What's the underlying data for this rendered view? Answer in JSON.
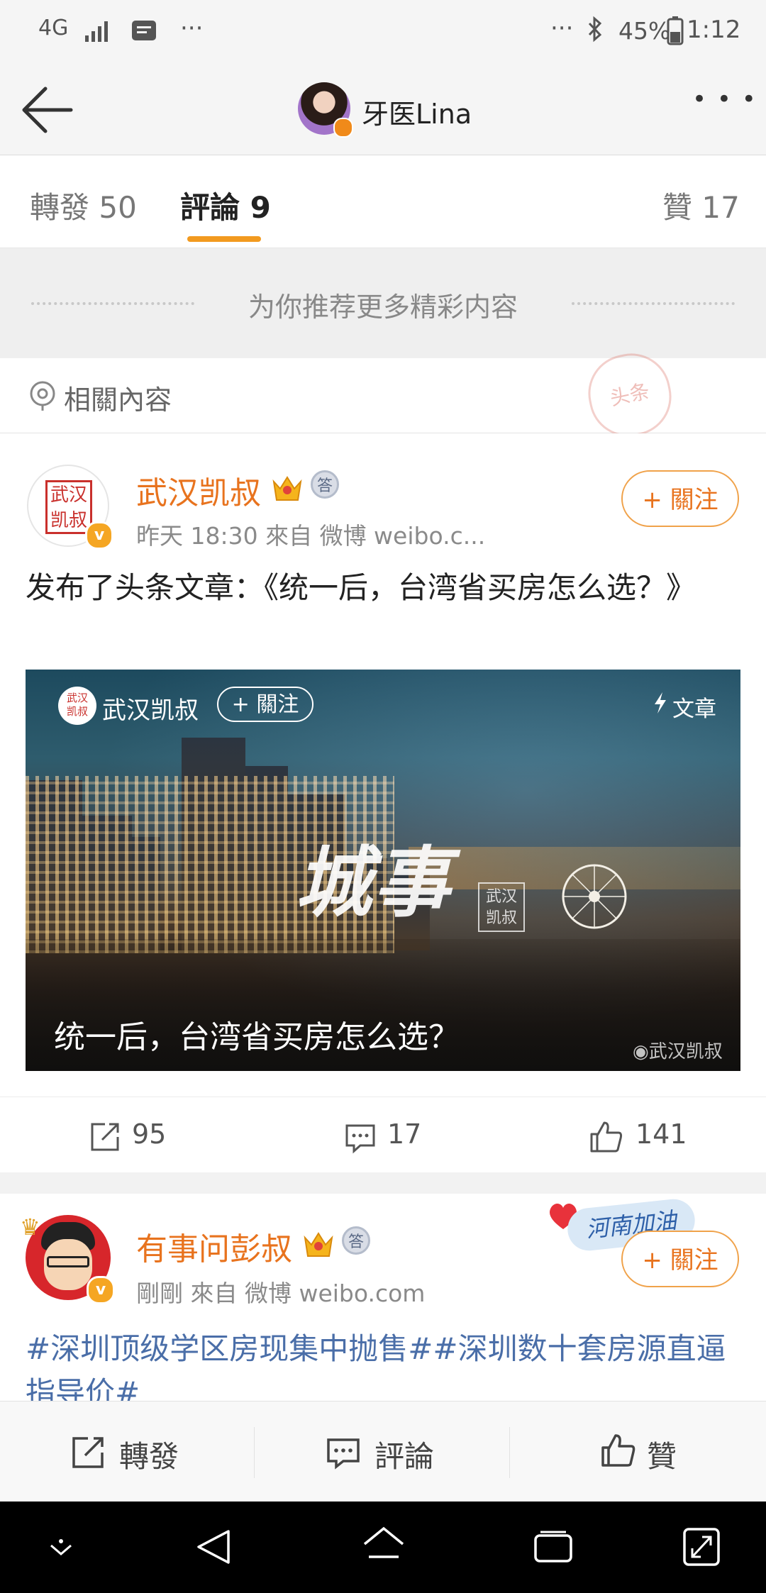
{
  "status_bar": {
    "network": "4G",
    "battery": "45%",
    "time": "1:12",
    "dots_left": "···",
    "dots_right": "···"
  },
  "header": {
    "title": "牙医Lina",
    "more_label": "• • •"
  },
  "tabs": {
    "repost": "轉發 50",
    "comment": "評論 9",
    "like": "贊 17",
    "active_color": "#f29a1f"
  },
  "recommend": {
    "text": "为你推荐更多精彩内容"
  },
  "related": {
    "label": "相關內容"
  },
  "post1": {
    "avatar_text": "武汉\n凯叔",
    "name": "武汉凯叔",
    "badge": "答",
    "meta": "昨天 18:30   來自 微博 weibo.c...",
    "follow": "+ 關注",
    "text": "发布了头条文章：《统一后，台湾省买房怎么选？》",
    "article": {
      "source_name": "武汉凯叔",
      "follow": "+ 關注",
      "tag": "文章",
      "center_word": "城事",
      "stamp": "武汉\n凯叔",
      "title": "统一后，台湾省买房怎么选？",
      "watermark": "武汉凯叔"
    },
    "reposts": "95",
    "comments": "17",
    "likes": "141"
  },
  "post2": {
    "name": "有事问彭叔",
    "badge": "答",
    "meta": "剛剛   來自 微博 weibo.com",
    "follow": "+ 關注",
    "sticker": "河南加油",
    "text": "#深圳顶级学区房现集中抛售##深圳数十套房源直逼指导价#"
  },
  "toolbar": {
    "repost": "轉發",
    "comment": "評論",
    "like": "贊"
  },
  "colors": {
    "accent_orange": "#e8731e",
    "link_blue": "#4a6ea8"
  }
}
